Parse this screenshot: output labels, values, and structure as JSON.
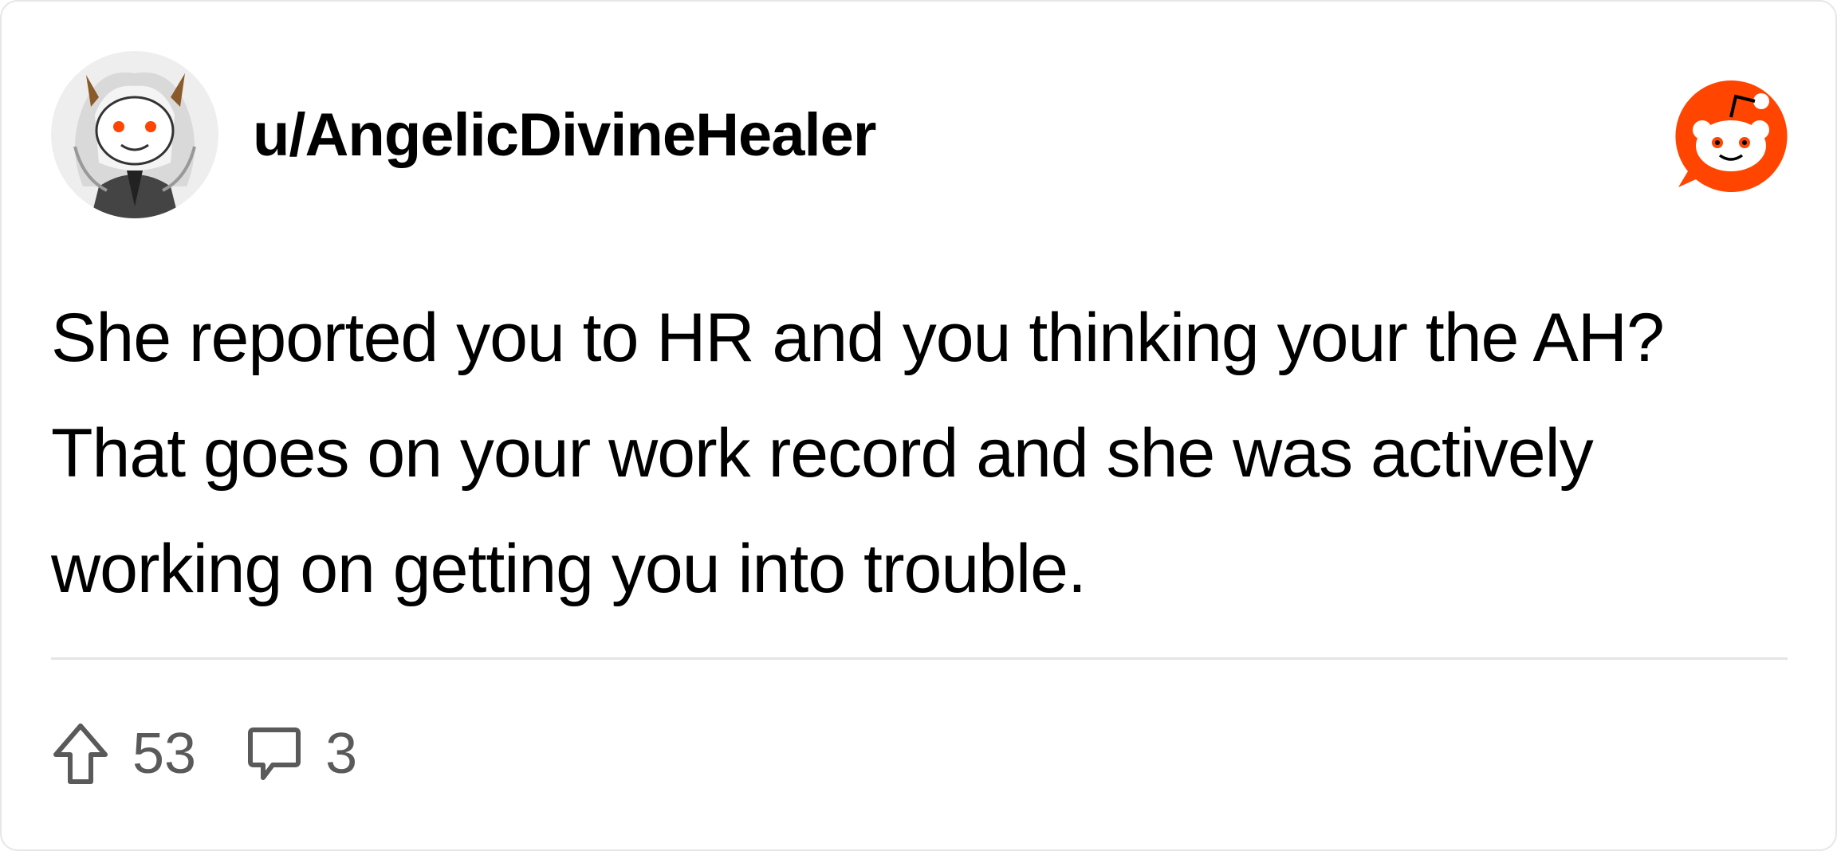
{
  "post": {
    "username": "u/AngelicDivineHealer",
    "body": "She reported you to HR and you thinking your the AH? That goes on your work record and she was actively working on getting you into trouble.",
    "upvotes": "53",
    "comments": "3"
  },
  "icons": {
    "avatar": "avatar-image",
    "brand": "reddit-logo-icon",
    "upvote": "upvote-arrow-icon",
    "comment": "comment-bubble-icon"
  },
  "colors": {
    "brand": "#FF4500",
    "meta_text": "#5a5a5a",
    "divider": "#e5e5e5"
  }
}
